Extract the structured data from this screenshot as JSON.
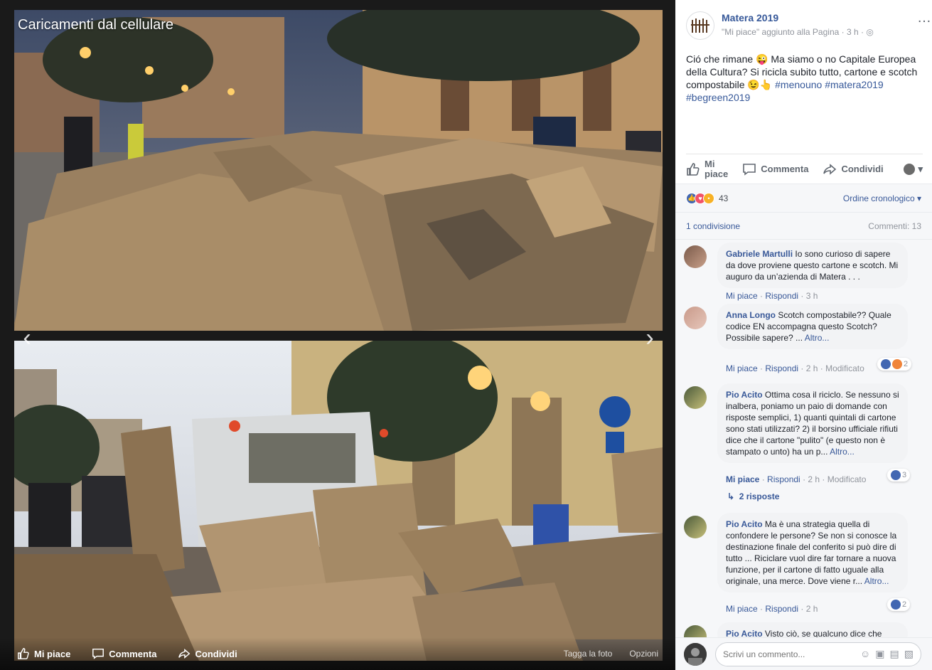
{
  "viewer": {
    "album_title": "Caricamenti dal cellulare",
    "actions": {
      "like": "Mi piace",
      "comment": "Commenta",
      "share": "Condividi"
    },
    "tag_photo": "Tagga la foto",
    "options": "Opzioni"
  },
  "post": {
    "page_name": "Matera 2019",
    "meta": "\"Mi piace\" aggiunto alla Pagina · 3 h · ",
    "text_part1": "Ció che rimane 😜 Ma siamo o no Capitale Europea della Cultura? Si ricicla subito tutto, cartone e scotch compostabile 😉👆 ",
    "hashtags": "#menouno #matera2019 #begreen2019",
    "actions": {
      "like_line1": "Mi",
      "like_line2": "piace",
      "comment": "Commenta",
      "share": "Condividi"
    },
    "reactions_count": "43",
    "order": "Ordine cronologico ▾",
    "shares": "1 condivisione",
    "comments_count": "Commenti: 13"
  },
  "comments": [
    {
      "author": "Gabriele Martulli",
      "text": " Io sono curioso di sapere da dove proviene questo cartone e scotch. Mi auguro da un’azienda di Matera . . .",
      "more": "",
      "like": "Mi piace",
      "reply": "Rispondi",
      "time": " · 3 h",
      "edited": "",
      "react_count": ""
    },
    {
      "author": "Anna Longo",
      "text": " Scotch compostabile?? Quale codice EN accompagna questo Scotch? Possibile sapere? ... ",
      "more": "Altro...",
      "like": "Mi piace",
      "reply": "Rispondi",
      "time": " · 2 h · ",
      "edited": "Modificato",
      "react_count": "2"
    },
    {
      "author": "Pio Acito",
      "text": " Ottima cosa il riciclo. Se nessuno si inalbera, poniamo un paio di domande con risposte semplici, 1) quanti quintali di cartone sono stati utilizzati? 2) il borsino ufficiale rifiuti dice che il cartone \"pulito\" (e questo non è stampato o unto) ha un p... ",
      "more": "Altro...",
      "like": "Mi piace",
      "reply": "Rispondi",
      "time": " · 2 h · ",
      "edited": "Modificato",
      "react_count": "3",
      "replies": "2 risposte"
    },
    {
      "author": "Pio Acito",
      "text": " Ma è una strategia quella di confondere le persone? Se non si conosce la destinazione finale del conferito si può dire di tutto ... Riciclare vuol dire far tornare a nuova funzione, per il cartone di fatto uguale alla originale, una merce. Dove viene r... ",
      "more": "Altro...",
      "like": "Mi piace",
      "reply": "Rispondi",
      "time": " · 2 h",
      "edited": "",
      "react_count": "2"
    },
    {
      "author": "Pio Acito",
      "text": " Visto ciò, se qualcuno dice che"
    }
  ],
  "composer": {
    "placeholder": "Scrivi un commento..."
  },
  "colors": {
    "link_blue": "#385898",
    "like_blue": "#4267b2",
    "love_red": "#f25268",
    "bubble_grey": "#f2f3f5"
  }
}
